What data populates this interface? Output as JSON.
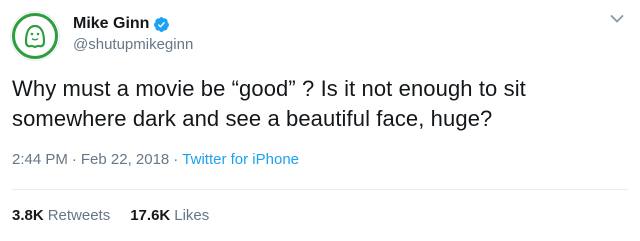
{
  "user": {
    "display_name": "Mike Ginn",
    "handle": "@shutupmikeginn",
    "verified": true
  },
  "tweet": {
    "text": "Why must a movie be “good” ? Is it not enough to sit somewhere dark and see a beautiful face, huge?",
    "time": "2:44 PM",
    "separator": "·",
    "date": "Feb 22, 2018",
    "source": "Twitter for iPhone"
  },
  "stats": {
    "retweets_count": "3.8K",
    "retweets_label": "Retweets",
    "likes_count": "17.6K",
    "likes_label": "Likes"
  },
  "icons": {
    "avatar": "ghost-avatar-icon",
    "verified": "verified-badge-icon",
    "menu": "chevron-down-icon"
  },
  "colors": {
    "text": "#14171a",
    "secondary": "#657786",
    "link": "#1da1f2",
    "avatar_green": "#2e9e3f",
    "divider": "#e6ecf0"
  }
}
